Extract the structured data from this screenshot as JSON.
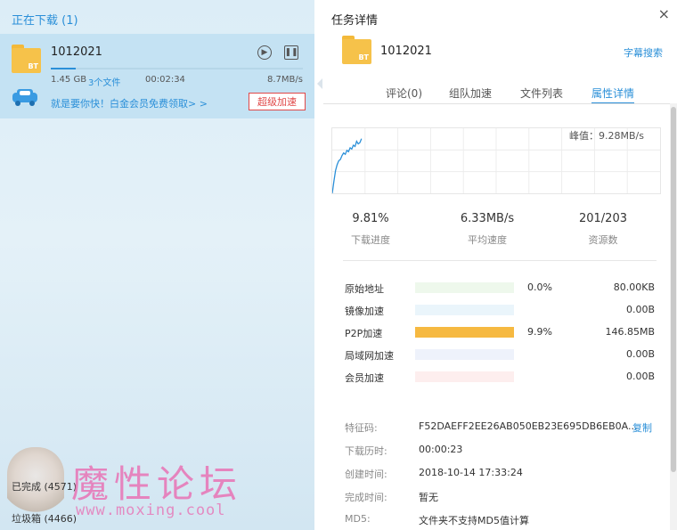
{
  "left": {
    "header": "正在下载 (1)",
    "task": {
      "name": "1012021",
      "folder_badge": "BT",
      "size": "1.45 GB",
      "files": "3个文件",
      "time": "00:02:34",
      "speed": "8.7MB/s",
      "progress": 0.0981,
      "promo": "就是要你快！白金会员免费领取> >",
      "super_accel": "超级加速"
    },
    "completed": "已完成 (4571)",
    "trash": "垃圾箱 (4466)",
    "watermark": "魔性论坛",
    "watermark_url": "www.moxing.cool"
  },
  "panel": {
    "title": "任务详情",
    "close": "×",
    "task_name": "1012021",
    "folder_badge": "BT",
    "subtitle_search": "字幕搜索",
    "tabs": [
      "评论(0)",
      "组队加速",
      "文件列表",
      "属性详情"
    ],
    "active_tab": 3,
    "peak": "峰值：9.28MB/s",
    "stats": [
      {
        "value": "9.81%",
        "label": "下载进度"
      },
      {
        "value": "6.33MB/s",
        "label": "平均速度"
      },
      {
        "value": "201/203",
        "label": "资源数"
      }
    ],
    "sources": [
      {
        "label": "原始地址",
        "pct": "0.0%",
        "size": "80.00KB",
        "fill": 0,
        "bg": "#eef8ec",
        "color": "#8fd07d"
      },
      {
        "label": "镜像加速",
        "pct": "",
        "size": "0.00B",
        "fill": 0,
        "bg": "#eaf5fb",
        "color": "#6ab8e3"
      },
      {
        "label": "P2P加速",
        "pct": "9.9%",
        "size": "146.85MB",
        "fill": 1,
        "bg": "#fdf1d8",
        "color": "#f6b941"
      },
      {
        "label": "局域网加速",
        "pct": "",
        "size": "0.00B",
        "fill": 0,
        "bg": "#eef2fb",
        "color": "#8ea2e0"
      },
      {
        "label": "会员加速",
        "pct": "",
        "size": "0.00B",
        "fill": 0,
        "bg": "#fdeeee",
        "color": "#ee8c8c"
      }
    ],
    "info": [
      {
        "label": "特征码:",
        "value": "F52DAEFF2EE26AB050EB23E695DB6EB0A..."
      },
      {
        "label": "下载历时:",
        "value": "00:00:23"
      },
      {
        "label": "创建时间:",
        "value": "2018-10-14 17:33:24"
      },
      {
        "label": "完成时间:",
        "value": "暂无"
      },
      {
        "label": "MD5:",
        "value": "文件夹不支持MD5值计算"
      }
    ],
    "copy": "复制",
    "speed_series": [
      0.0,
      0.18,
      0.35,
      0.44,
      0.5,
      0.52,
      0.58,
      0.62,
      0.6,
      0.66,
      0.64,
      0.7,
      0.68,
      0.74,
      0.72,
      0.8,
      0.76,
      0.78,
      0.84
    ]
  }
}
